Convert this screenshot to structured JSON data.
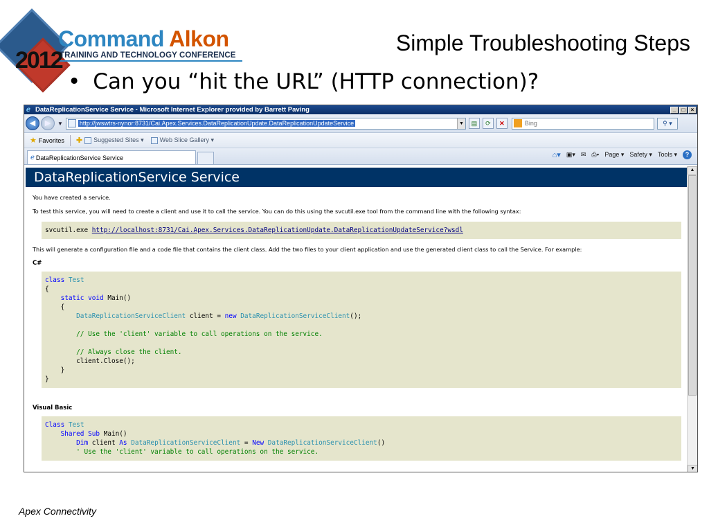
{
  "slide": {
    "logo": {
      "year": "2012",
      "brand_word1": "Command",
      "brand_word2": "Alkon",
      "tagline": "TRAINING AND TECHNOLOGY CONFERENCE"
    },
    "title": "Simple Troubleshooting Steps",
    "bullet": "Can you “hit the URL” (HTTP connection)?",
    "footer": "Apex Connectivity"
  },
  "browser": {
    "window_title": "DataReplicationService Service - Microsoft Internet Explorer provided by Barrett Paving",
    "address": "http://jwswtrs-nynor:8731/Cai.Apex.Services.DataReplicationUpdate.DataReplicationUpdateService",
    "search_placeholder": "Bing",
    "favorites_label": "Favorites",
    "favorites_links": [
      "Suggested Sites ▾",
      "Web Slice Gallery ▾"
    ],
    "tab_title": "DataReplicationService Service",
    "command_bar": [
      "Page ▾",
      "Safety ▾",
      "Tools ▾"
    ]
  },
  "page": {
    "heading": "DataReplicationService Service",
    "created_text": "You have created a service.",
    "test_text": "To test this service, you will need to create a client and use it to call the service. You can do this using the svcutil.exe tool from the command line with the following syntax:",
    "svcutil_cmd": "svcutil.exe ",
    "svcutil_url": "http://localhost:8731/Cai.Apex.Services.DataReplicationUpdate.DataReplicationUpdateService?wsdl",
    "generate_text": "This will generate a configuration file and a code file that contains the client class. Add the two files to your client application and use the generated client class to call the Service. For example:",
    "csharp_label": "C#",
    "vb_label": "Visual Basic"
  },
  "colors": {
    "heading_bg": "#003366",
    "code_bg": "#e5e5cc",
    "keyword": "#0000ff",
    "type": "#2b91af",
    "comment": "#008000"
  }
}
